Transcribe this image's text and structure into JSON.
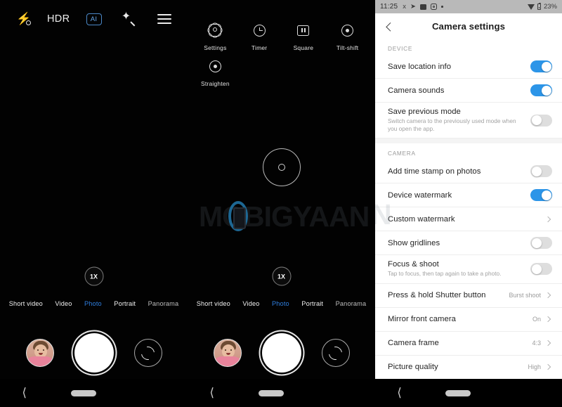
{
  "camera": {
    "topbar": {
      "flash": "flash-off-icon",
      "hdr_label": "HDR",
      "ai_label": "AI",
      "beauty": "magic-wand-icon",
      "menu": "hamburger-menu-icon"
    },
    "menu_items": [
      {
        "label": "Settings",
        "icon": "gear-icon"
      },
      {
        "label": "Timer",
        "icon": "clock-icon"
      },
      {
        "label": "Square",
        "icon": "square-crop-icon"
      },
      {
        "label": "Tilt-shift",
        "icon": "tilt-shift-icon"
      },
      {
        "label": "Straighten",
        "icon": "straighten-icon"
      }
    ],
    "zoom_level": "1X",
    "modes": [
      {
        "label": "Short video",
        "active": false
      },
      {
        "label": "Video",
        "active": false
      },
      {
        "label": "Photo",
        "active": true
      },
      {
        "label": "Portrait",
        "active": false
      },
      {
        "label": "Panorama",
        "active": false
      }
    ],
    "active_mode_color": "#2f7fe0",
    "bottom": {
      "gallery_thumb": "gallery-thumbnail",
      "shutter": "shutter-button",
      "flip": "switch-camera-icon"
    },
    "navbar": {
      "back": "back-icon",
      "home": "home-pill"
    }
  },
  "settings": {
    "status_bar": {
      "time": "11:25",
      "icons": [
        "lightning-app-icon",
        "telegram-icon",
        "youtube-icon",
        "instagram-icon",
        "more-dot-icon"
      ],
      "wifi": "wifi-icon",
      "battery": "battery-icon",
      "battery_text": "23%"
    },
    "header": {
      "back": "back-chevron-icon",
      "title": "Camera settings"
    },
    "sections": [
      {
        "heading": "DEVICE",
        "rows": [
          {
            "title": "Save location info",
            "sub": "",
            "control": "toggle",
            "on": true,
            "value": ""
          },
          {
            "title": "Camera sounds",
            "sub": "",
            "control": "toggle",
            "on": true,
            "value": ""
          },
          {
            "title": "Save previous mode",
            "sub": "Switch camera to the previously used mode when you open the app.",
            "control": "toggle",
            "on": false,
            "value": ""
          }
        ]
      },
      {
        "heading": "CAMERA",
        "rows": [
          {
            "title": "Add time stamp on photos",
            "sub": "",
            "control": "toggle",
            "on": false,
            "value": ""
          },
          {
            "title": "Device watermark",
            "sub": "",
            "control": "toggle",
            "on": true,
            "value": ""
          },
          {
            "title": "Custom watermark",
            "sub": "",
            "control": "chevron",
            "on": false,
            "value": ""
          },
          {
            "title": "Show gridlines",
            "sub": "",
            "control": "toggle",
            "on": false,
            "value": ""
          },
          {
            "title": "Focus & shoot",
            "sub": "Tap to focus, then tap again to take a photo.",
            "control": "toggle",
            "on": false,
            "value": ""
          },
          {
            "title": "Press & hold Shutter button",
            "sub": "",
            "control": "chevron",
            "on": false,
            "value": "Burst shoot"
          },
          {
            "title": "Mirror front camera",
            "sub": "",
            "control": "chevron",
            "on": false,
            "value": "On"
          },
          {
            "title": "Camera frame",
            "sub": "",
            "control": "chevron",
            "on": false,
            "value": "4:3"
          },
          {
            "title": "Picture quality",
            "sub": "",
            "control": "chevron",
            "on": false,
            "value": "High"
          }
        ]
      }
    ],
    "toggle_on_color": "#2c95e8",
    "toggle_off_color": "#dedede"
  },
  "watermark": {
    "text": "MOBIGYAAN",
    "accent_color": "#1f6d9b"
  }
}
